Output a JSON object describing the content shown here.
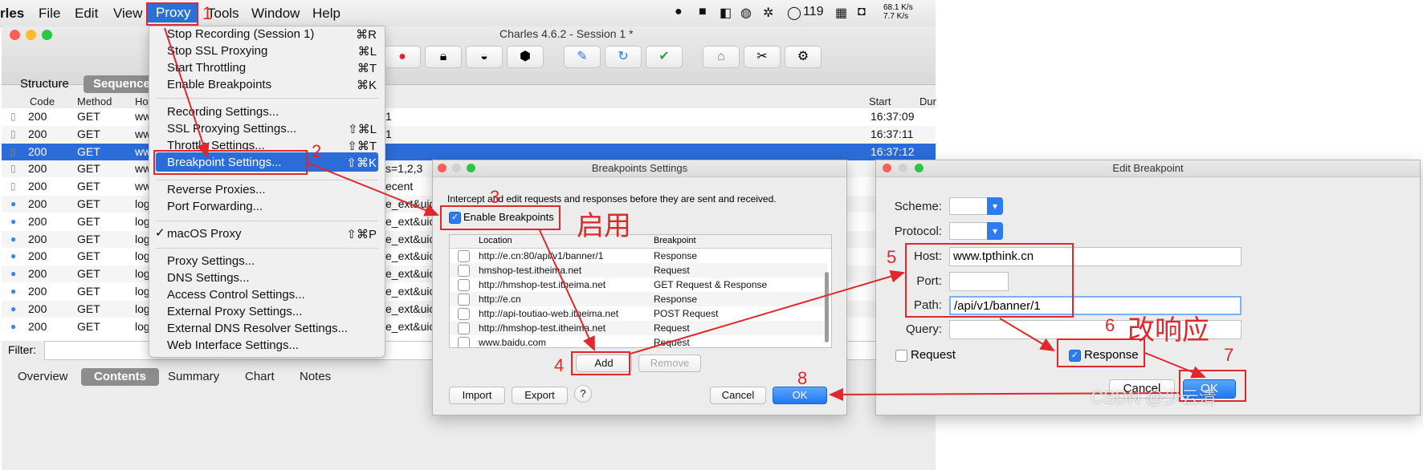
{
  "menubar": {
    "app": "rles",
    "items": [
      "File",
      "Edit",
      "View",
      "Proxy",
      "Tools",
      "Window",
      "Help"
    ],
    "tray_count": "119",
    "net_up": "68.1 K/s",
    "net_down": "7.7 K/s"
  },
  "window": {
    "title": "Charles 4.6.2 - Session 1 *",
    "view_tabs": [
      "Structure",
      "Sequence"
    ],
    "columns": [
      "Code",
      "Method",
      "Ho",
      "Start",
      "Dur"
    ],
    "rows": [
      {
        "code": "200",
        "method": "GET",
        "host": "ww",
        "extra": "1",
        "start": "16:37:09"
      },
      {
        "code": "200",
        "method": "GET",
        "host": "ww",
        "extra": "1",
        "start": "16:37:11"
      },
      {
        "code": "200",
        "method": "GET",
        "host": "ww",
        "extra": "",
        "start": "16:37:12"
      },
      {
        "code": "200",
        "method": "GET",
        "host": "ww",
        "extra": "s=1,2,3",
        "start": ""
      },
      {
        "code": "200",
        "method": "GET",
        "host": "ww",
        "extra": "ecent",
        "start": ""
      },
      {
        "code": "200",
        "method": "GET",
        "host": "log",
        "extra": "e_ext&uic",
        "start": ""
      },
      {
        "code": "200",
        "method": "GET",
        "host": "log",
        "extra": "e_ext&uic",
        "start": ""
      },
      {
        "code": "200",
        "method": "GET",
        "host": "log",
        "extra": "e_ext&uic",
        "start": ""
      },
      {
        "code": "200",
        "method": "GET",
        "host": "log",
        "extra": "e_ext&uic",
        "start": ""
      },
      {
        "code": "200",
        "method": "GET",
        "host": "log",
        "extra": "e_ext&uic",
        "start": ""
      },
      {
        "code": "200",
        "method": "GET",
        "host": "log",
        "extra": "e_ext&uic",
        "start": ""
      },
      {
        "code": "200",
        "method": "GET",
        "host": "log",
        "extra": "e_ext&uic",
        "start": ""
      },
      {
        "code": "200",
        "method": "GET",
        "host": "log",
        "extra": "e_ext&uic",
        "start": ""
      }
    ],
    "filter_label": "Filter:",
    "bottom_tabs": [
      "Overview",
      "Contents",
      "Summary",
      "Chart",
      "Notes"
    ]
  },
  "proxy_menu": {
    "items": [
      {
        "label": "Stop Recording (Session 1)",
        "shortcut": "⌘R"
      },
      {
        "label": "Stop SSL Proxying",
        "shortcut": "⌘L"
      },
      {
        "label": "Start Throttling",
        "shortcut": "⌘T"
      },
      {
        "label": "Enable Breakpoints",
        "shortcut": "⌘K"
      },
      {
        "label": "Recording Settings...",
        "shortcut": ""
      },
      {
        "label": "SSL Proxying Settings...",
        "shortcut": "⇧⌘L"
      },
      {
        "label": "Throttle Settings...",
        "shortcut": "⇧⌘T"
      },
      {
        "label": "Breakpoint Settings...",
        "shortcut": "⇧⌘K"
      },
      {
        "label": "Reverse Proxies...",
        "shortcut": ""
      },
      {
        "label": "Port Forwarding...",
        "shortcut": ""
      },
      {
        "label": "macOS Proxy",
        "shortcut": "⇧⌘P"
      },
      {
        "label": "Proxy Settings...",
        "shortcut": ""
      },
      {
        "label": "DNS Settings...",
        "shortcut": ""
      },
      {
        "label": "Access Control Settings...",
        "shortcut": ""
      },
      {
        "label": "External Proxy Settings...",
        "shortcut": ""
      },
      {
        "label": "External DNS Resolver Settings...",
        "shortcut": ""
      },
      {
        "label": "Web Interface Settings...",
        "shortcut": ""
      }
    ],
    "checkmark": "✓"
  },
  "breakpoints_dialog": {
    "title": "Breakpoints Settings",
    "intro": "Intercept and edit requests and responses before they are sent and received.",
    "enable_label": "Enable Breakpoints",
    "columns": [
      "Location",
      "Breakpoint"
    ],
    "rows": [
      {
        "location": "http://e.cn:80/api/v1/banner/1",
        "type": "Response"
      },
      {
        "location": "hmshop-test.itheima.net",
        "type": "Request"
      },
      {
        "location": "http://hmshop-test.itheima.net",
        "type": "GET Request & Response"
      },
      {
        "location": "http://e.cn",
        "type": "Response"
      },
      {
        "location": "http://api-toutiao-web.itheima.net",
        "type": "POST Request"
      },
      {
        "location": "http://hmshop-test.itheima.net",
        "type": "Request"
      },
      {
        "location": "www.baidu.com",
        "type": "Request"
      }
    ],
    "add": "Add",
    "remove": "Remove",
    "import": "Import",
    "export": "Export",
    "help": "?",
    "cancel": "Cancel",
    "ok": "OK"
  },
  "edit_dialog": {
    "title": "Edit Breakpoint",
    "scheme_label": "Scheme:",
    "protocol_label": "Protocol:",
    "host_label": "Host:",
    "host_value": "www.tpthink.cn",
    "port_label": "Port:",
    "path_label": "Path:",
    "path_value": "/api/v1/banner/1",
    "query_label": "Query:",
    "request_label": "Request",
    "response_label": "Response",
    "cancel": "Cancel",
    "ok": "OK"
  },
  "annotations": {
    "n1": "1",
    "n2": "2",
    "n3": "3",
    "n4": "4",
    "n5": "5",
    "n6": "6",
    "n7": "7",
    "n8": "8",
    "enable_cn": "启用",
    "modify_cn": "改响应",
    "watermark": "CSDN @少云清"
  },
  "colors": {
    "annotation_red": "#e0272b",
    "selection_blue": "#2c6cd8"
  }
}
